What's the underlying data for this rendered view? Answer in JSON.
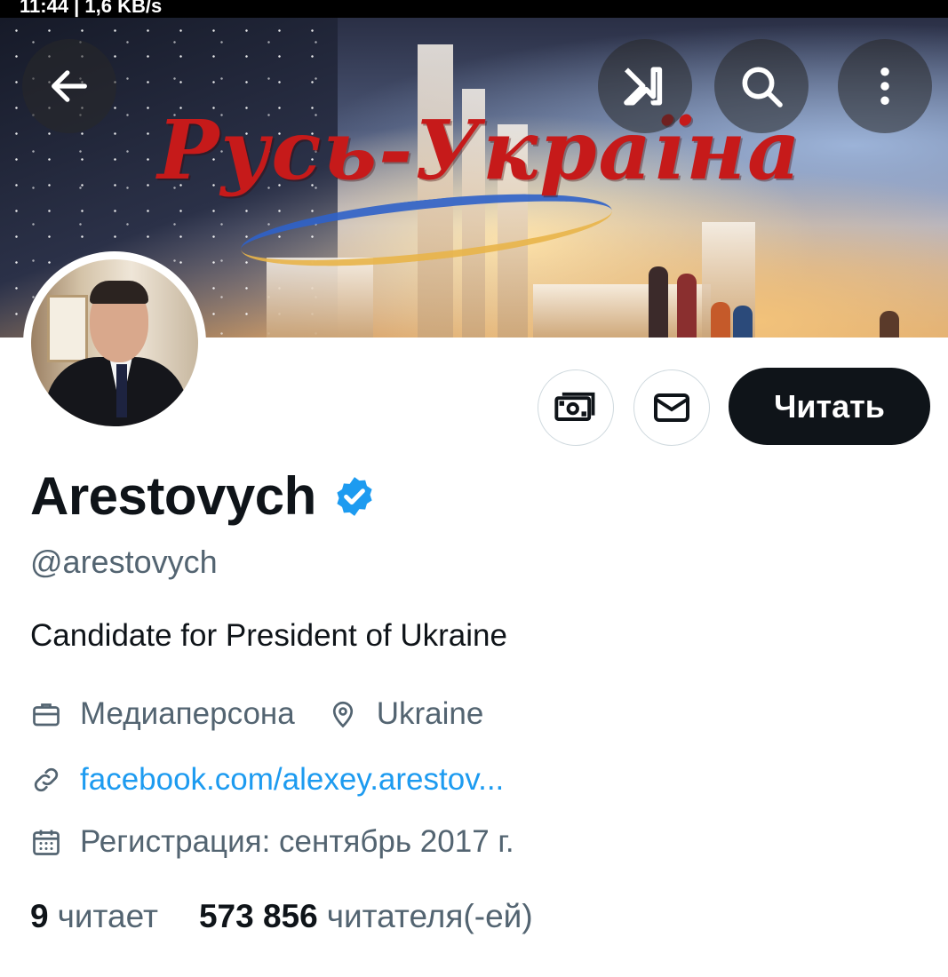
{
  "status_bar": {
    "text": "11:44 | 1,6 KB/s"
  },
  "banner": {
    "title": "Русь-Україна"
  },
  "top_bar": {
    "back_icon": "arrow-left-icon",
    "grok_icon": "grok-icon",
    "search_icon": "search-icon",
    "more_icon": "more-vertical-icon"
  },
  "profile": {
    "name": "Arestovych",
    "handle": "@arestovych",
    "bio": "Candidate for President of Ukraine",
    "category": "Медиаперсона",
    "location": "Ukraine",
    "website": "facebook.com/alexey.arestov...",
    "joined": "Регистрация: сентябрь 2017 г.",
    "verified_color": "#1d9bf0"
  },
  "actions": {
    "subscribe_icon": "money-icon",
    "message_icon": "envelope-icon",
    "follow_label": "Читать"
  },
  "stats": {
    "following_count": "9",
    "following_label": "читает",
    "followers_count": "573 856",
    "followers_label": "читателя(-ей)"
  }
}
